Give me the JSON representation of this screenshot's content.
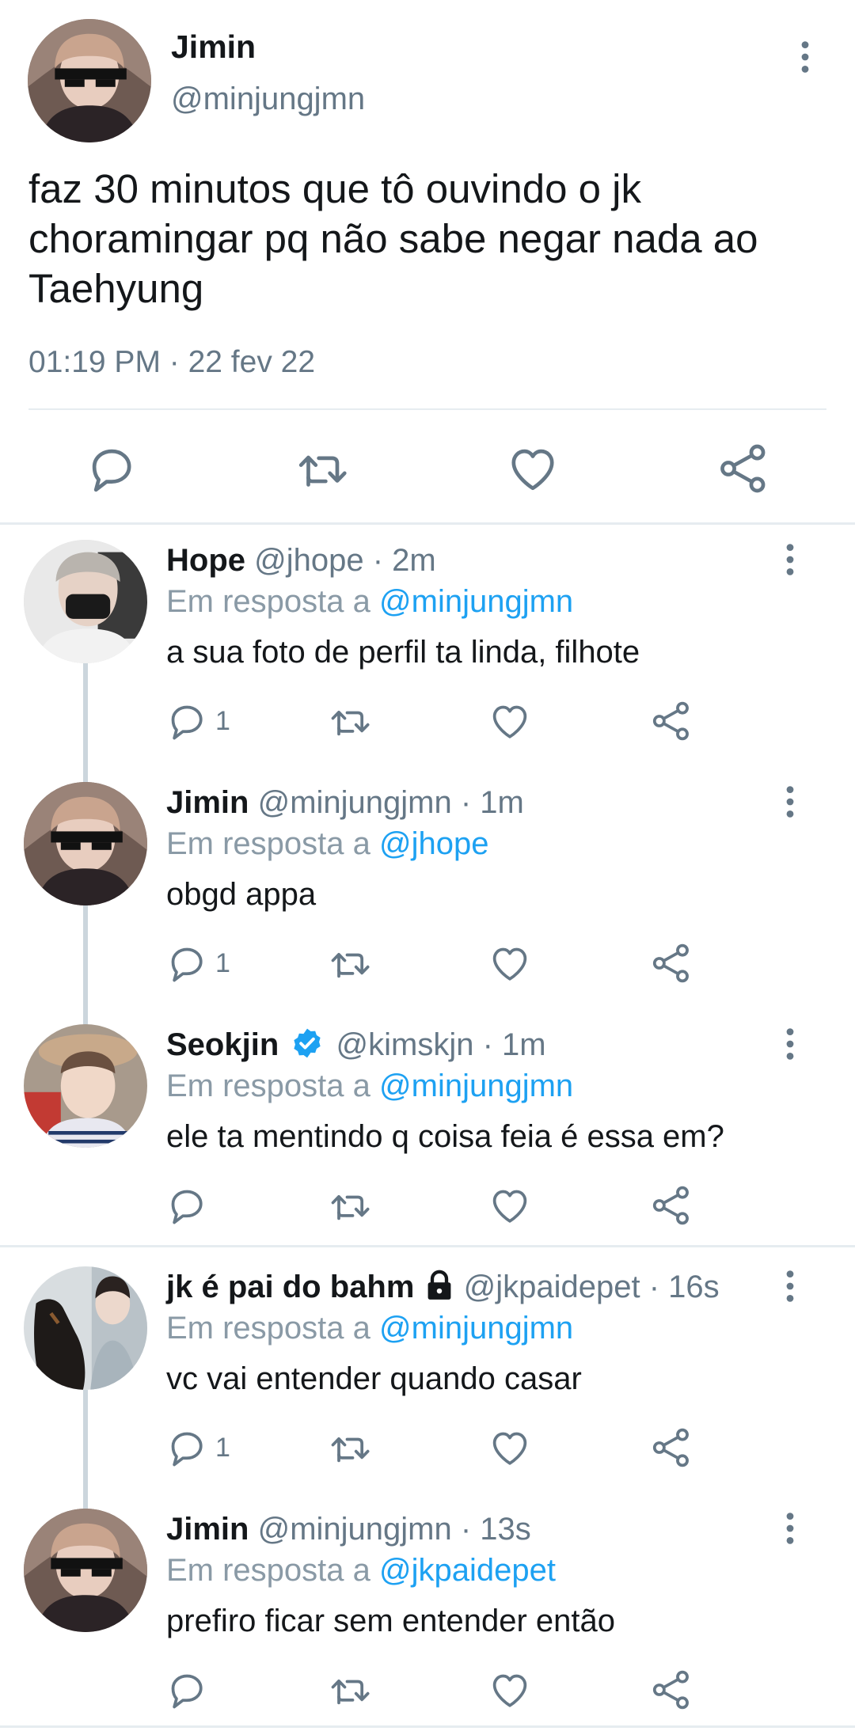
{
  "main_tweet": {
    "author_name": "Jimin",
    "author_handle": "@minjungjmn",
    "text": "faz 30 minutos que tô ouvindo o jk choramingar pq não sabe negar nada ao Taehyung",
    "timestamp": "01:19 PM · 22 fev 22"
  },
  "replies": [
    {
      "name": "Hope",
      "handle": "@jhope · 2m",
      "reply_prefix": "Em resposta a",
      "reply_to": "@minjungjmn",
      "text": "a sua foto de perfil ta linda, filhote",
      "reply_count": "1"
    },
    {
      "name": "Jimin",
      "handle": "@minjungjmn · 1m",
      "reply_prefix": "Em resposta a",
      "reply_to": "@jhope",
      "text": "obgd appa",
      "reply_count": "1"
    },
    {
      "name": "Seokjin",
      "handle": "@kimskjn · 1m",
      "reply_prefix": "Em resposta a",
      "reply_to": "@minjungjmn",
      "text": "ele ta mentindo q coisa feia é essa em?",
      "reply_count": "",
      "verified": true
    },
    {
      "name": "jk é pai do bahm",
      "handle": "@jkpaidepet · 16s",
      "reply_prefix": "Em resposta a",
      "reply_to": "@minjungjmn",
      "text": "vc vai entender quando casar",
      "reply_count": "1",
      "locked": true
    },
    {
      "name": "Jimin",
      "handle": "@minjungjmn · 13s",
      "reply_prefix": "Em resposta a",
      "reply_to": "@jkpaidepet",
      "text": "prefiro ficar sem entender então",
      "reply_count": ""
    }
  ],
  "colors": {
    "accent": "#1da1f2",
    "secondary_text": "#657786",
    "divider": "#e6ecf0",
    "thread_line": "#ccd6dd"
  },
  "icons": [
    "more-vertical-icon",
    "reply-icon",
    "retweet-icon",
    "like-icon",
    "share-icon",
    "verified-badge-icon",
    "lock-icon"
  ]
}
